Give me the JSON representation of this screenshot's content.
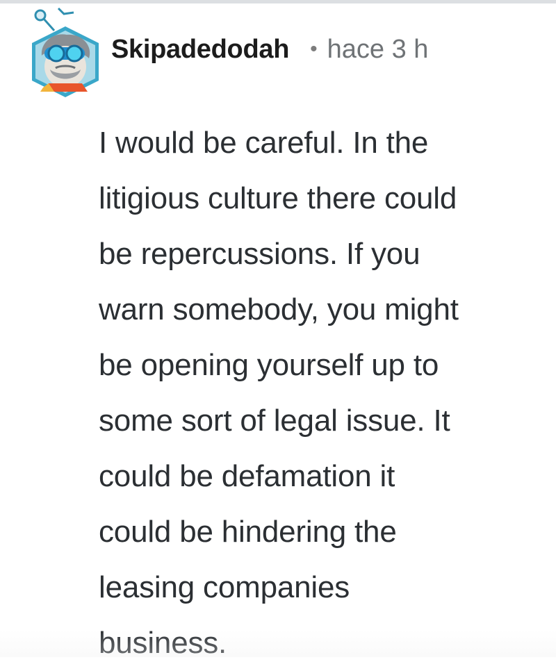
{
  "comment": {
    "author": {
      "username": "Skipadedodah",
      "avatar_icon": "robot-scientist-avatar-icon"
    },
    "separator": "•",
    "timestamp": "hace 3 h",
    "body_lines": [
      "I would be careful. In the",
      "litigious culture there could",
      "be repercussions. If you",
      "warn somebody, you might",
      "be opening yourself up to",
      "some sort of legal issue. It",
      "could be defamation it",
      "could be hindering the",
      "leasing companies",
      "business."
    ]
  },
  "colors": {
    "username": "#1c1c1c",
    "meta": "#6f7376",
    "body": "#2b2f33",
    "avatar_border": "#3aa7c9"
  }
}
